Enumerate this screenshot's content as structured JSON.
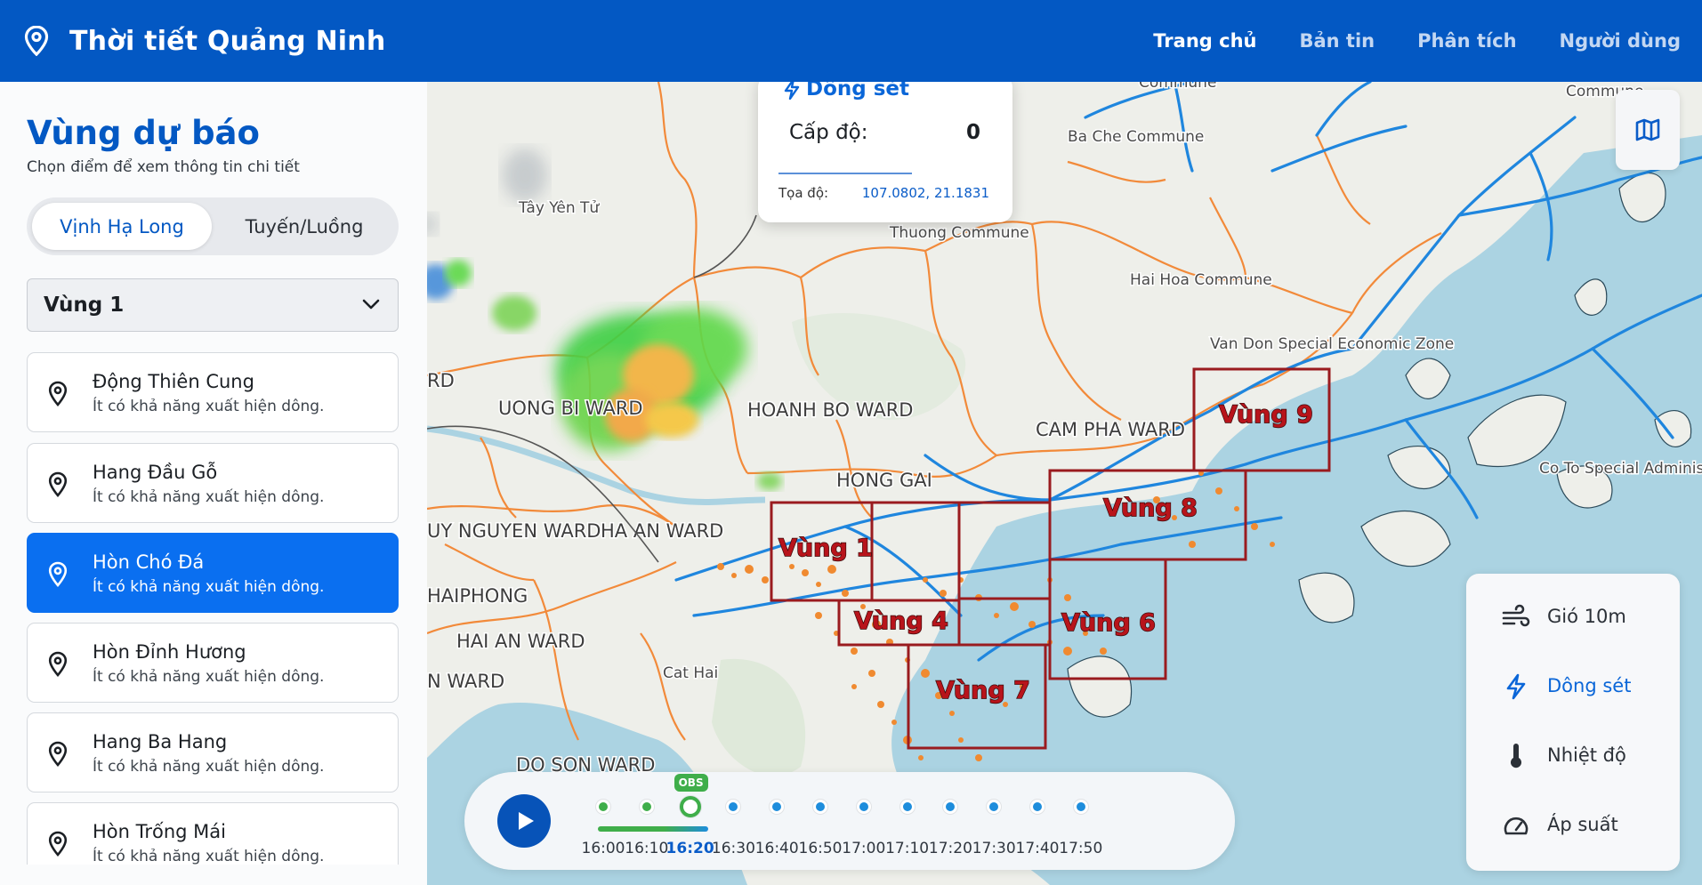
{
  "header": {
    "title": "Thời tiết Quảng Ninh",
    "nav": [
      "Trang chủ",
      "Bản tin",
      "Phân tích",
      "Người dùng"
    ],
    "active_nav": "Trang chủ"
  },
  "sidebar": {
    "title": "Vùng dự báo",
    "subtitle": "Chọn điểm để xem thông tin chi tiết",
    "tabs": [
      "Vịnh Hạ Long",
      "Tuyến/Luồng"
    ],
    "active_tab": "Vịnh Hạ Long",
    "select_value": "Vùng 1",
    "items": [
      {
        "name": "Động Thiên Cung",
        "desc": "Ít có khả năng xuất hiện dông."
      },
      {
        "name": "Hang Đầu Gỗ",
        "desc": "Ít có khả năng xuất hiện dông."
      },
      {
        "name": "Hòn Chó Đá",
        "desc": "Ít có khả năng xuất hiện dông."
      },
      {
        "name": "Hòn Đỉnh Hương",
        "desc": "Ít có khả năng xuất hiện dông."
      },
      {
        "name": "Hang Ba Hang",
        "desc": "Ít có khả năng xuất hiện dông."
      },
      {
        "name": "Hòn Trống Mái",
        "desc": "Ít có khả năng xuất hiện dông."
      }
    ],
    "selected_index": 2
  },
  "tooltip": {
    "title": "Dông sét",
    "level_label": "Cấp độ:",
    "level_value": "0",
    "coord_label": "Tọa độ:",
    "coord_value": "107.0802, 21.1831"
  },
  "map": {
    "place_labels": [
      "Tây Yên Tử",
      "Ba Che Commune",
      "Hai Hoa Commune",
      "Van Don Special Economic Zone",
      "Co To Special Administrative Region",
      "UONG BI WARD",
      "HOANH BO WARD",
      "CAM PHA WARD",
      "HONG GAI",
      "HA AN WARD",
      "UY NGUYEN WARD",
      "HAIPHONG",
      "HAI AN WARD",
      "Cat Hai",
      "DO SON WARD",
      "Thuong Commune",
      "Commune",
      "Commune",
      "RD",
      "N WARD"
    ],
    "zones": [
      "Vùng 1",
      "Vùng 4",
      "Vùng 6",
      "Vùng 7",
      "Vùng 8",
      "Vùng 9"
    ],
    "colors": {
      "zone_border": "#9a1b1f",
      "radar_green": "#3fcf44",
      "radar_orange": "#f2a33a",
      "water": "#abd3e2",
      "boundary": "#f28a3a",
      "route": "#1f86de"
    }
  },
  "layers": {
    "items": [
      {
        "label": "Gió 10m",
        "icon": "wind-icon"
      },
      {
        "label": "Dông sét",
        "icon": "lightning-icon"
      },
      {
        "label": "Nhiệt độ",
        "icon": "thermometer-icon"
      },
      {
        "label": "Áp suất",
        "icon": "gauge-icon"
      }
    ],
    "active": "Dông sét"
  },
  "timeline": {
    "obs_label": "OBS",
    "times": [
      "16:00",
      "16:10",
      "16:20",
      "16:30",
      "16:40",
      "16:50",
      "17:00",
      "17:10",
      "17:20",
      "17:30",
      "17:40",
      "17:50"
    ],
    "current": "16:20"
  }
}
